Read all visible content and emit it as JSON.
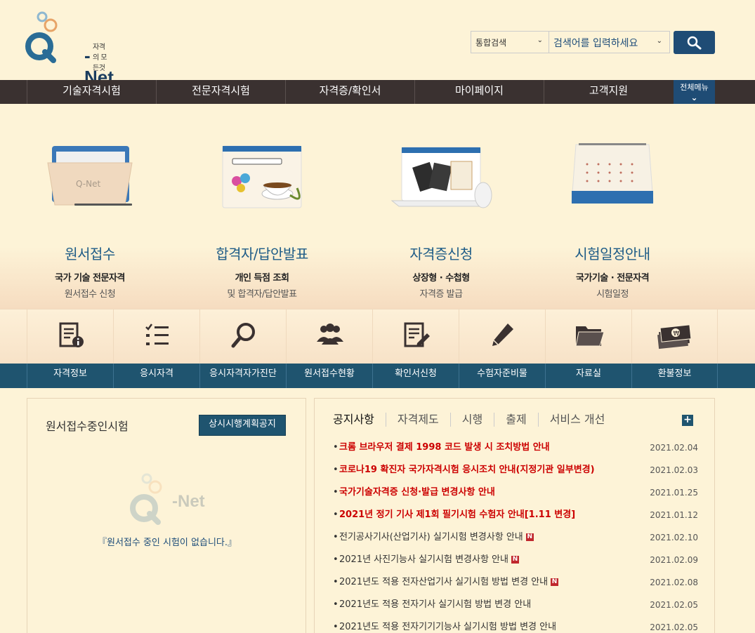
{
  "logo": {
    "tagline": "자격의 모든것",
    "name": "-Net"
  },
  "search": {
    "scope": "통합검색",
    "placeholder": "검색어를 입력하세요"
  },
  "nav": {
    "items": [
      "기술자격시험",
      "전문자격시험",
      "자격증/확인서",
      "마이페이지",
      "고객지원"
    ],
    "all_menu": "전체메뉴"
  },
  "hero": [
    {
      "title": "원서접수",
      "sub1": "국가 기술 전문자격",
      "sub2": "원서접수 신청"
    },
    {
      "title": "합격자/답안발표",
      "sub1": "개인 득점 조회",
      "sub2": "및 합격자/답안발표"
    },
    {
      "title": "자격증신청",
      "sub1": "상장형 · 수첩형",
      "sub2": "자격증 발급"
    },
    {
      "title": "시험일정안내",
      "sub1": "국가기술 · 전문자격",
      "sub2": "시험일정"
    }
  ],
  "quick": [
    "자격정보",
    "응시자격",
    "응시자격자가진단",
    "원서접수현황",
    "확인서신청",
    "수험자준비물",
    "자료실",
    "환불정보"
  ],
  "left_panel": {
    "title": "원서접수중인시험",
    "button": "상시시행계획공지",
    "empty": "『원서접수 중인 시험이 없습니다.』"
  },
  "notice": {
    "tabs": [
      "공지사항",
      "자격제도",
      "시행",
      "출제",
      "서비스 개선"
    ],
    "plus": "+",
    "items": [
      {
        "title": "크롬 브라우저 결제 1998 코드 발생 시 조치방법 안내",
        "date": "2021.02.04",
        "hot": true,
        "new": false
      },
      {
        "title": "코로나19 확진자 국가자격시험 응시조치 안내(지정기관 일부변경)",
        "date": "2021.02.03",
        "hot": true,
        "new": false
      },
      {
        "title": "국가기술자격증 신청·발급 변경사항 안내",
        "date": "2021.01.25",
        "hot": true,
        "new": false
      },
      {
        "title": "2021년 정기 기사 제1회 필기시험 수험자 안내[1.11 변경]",
        "date": "2021.01.12",
        "hot": true,
        "new": false
      },
      {
        "title": "전기공사기사(산업기사) 실기시험 변경사항 안내",
        "date": "2021.02.10",
        "hot": false,
        "new": true
      },
      {
        "title": "2021년 사진기능사 실기시험 변경사항 안내",
        "date": "2021.02.09",
        "hot": false,
        "new": true
      },
      {
        "title": "2021년도 적용 전자산업기사 실기시험 방법 변경 안내",
        "date": "2021.02.08",
        "hot": false,
        "new": true
      },
      {
        "title": "2021년도 적용 전자기사 실기시험 방법 변경 안내",
        "date": "2021.02.05",
        "hot": false,
        "new": false
      },
      {
        "title": "2021년도 적용 전자기기기능사 실기시험 방법 변경 안내",
        "date": "2021.02.05",
        "hot": false,
        "new": false
      }
    ],
    "new_badge": "N",
    "bullet": "•"
  }
}
